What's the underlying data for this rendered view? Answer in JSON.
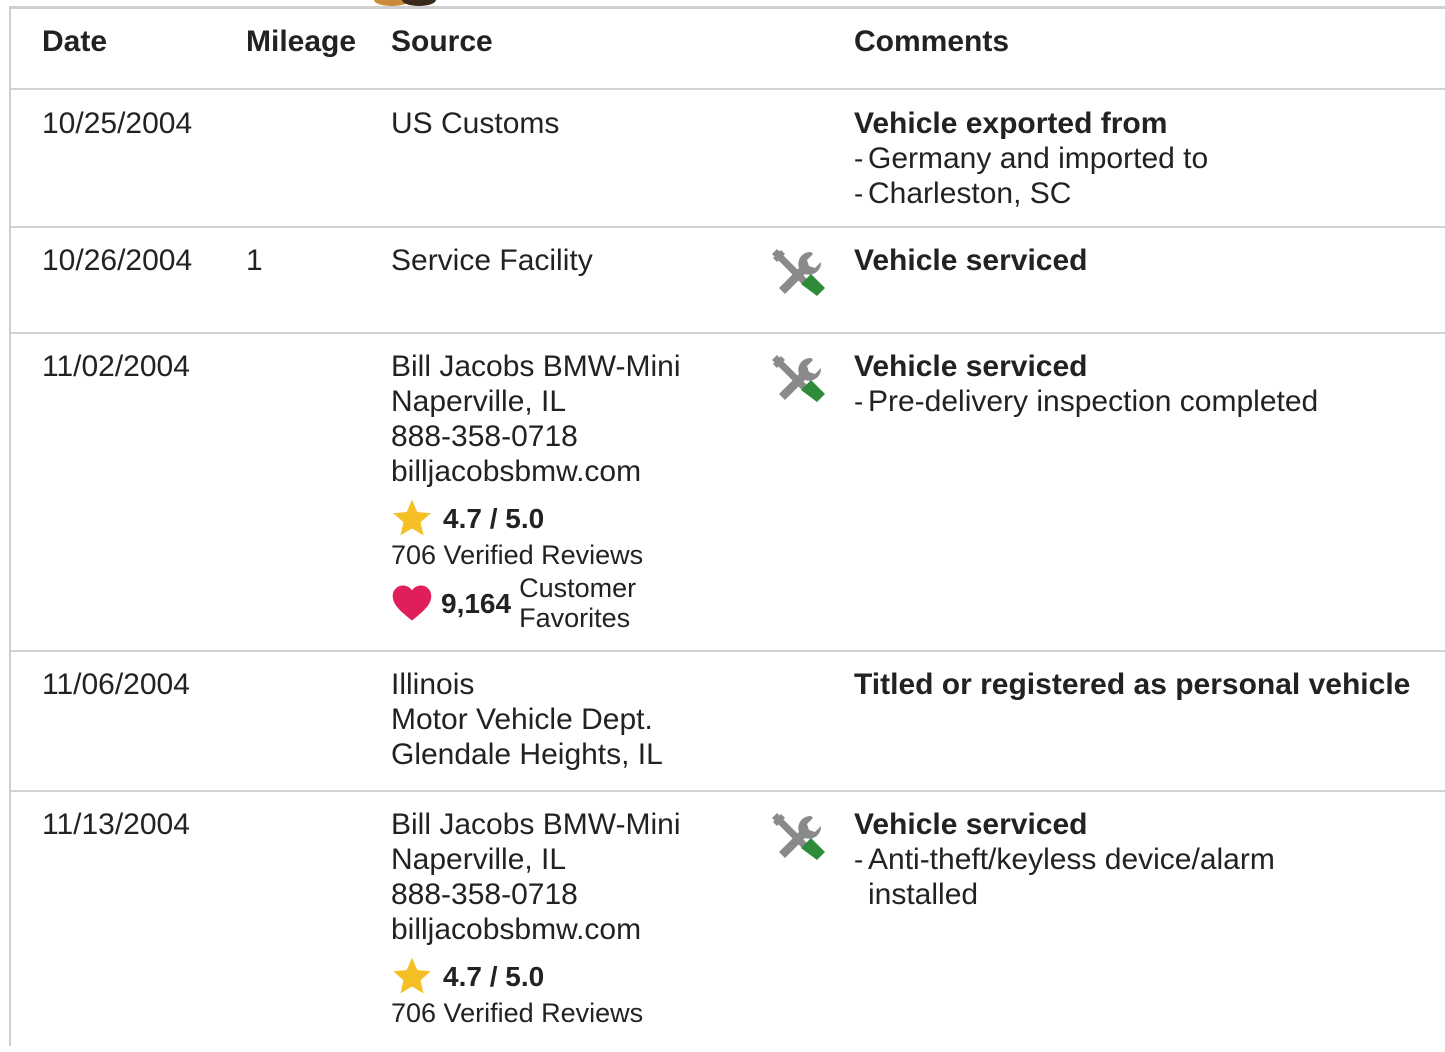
{
  "table": {
    "headers": {
      "date": "Date",
      "mileage": "Mileage",
      "source": "Source",
      "comments": "Comments"
    },
    "rows": [
      {
        "date": "10/25/2004",
        "mileage": "",
        "source": [
          "US Customs"
        ],
        "icon": "",
        "comment_title": "Vehicle exported from",
        "comment_items": [
          "Germany and imported to",
          "Charleston, SC"
        ]
      },
      {
        "date": "10/26/2004",
        "mileage": "1",
        "source": [
          "Service Facility"
        ],
        "icon": "wrench-screwdriver-icon",
        "comment_title": "Vehicle serviced",
        "comment_items": []
      },
      {
        "date": "11/02/2004",
        "mileage": "",
        "source": [
          "Bill Jacobs BMW-Mini",
          "Naperville, IL",
          "888-358-0718",
          "billjacobsbmw.com"
        ],
        "rating": "4.7 / 5.0",
        "reviews": "706 Verified Reviews",
        "favorites_count": "9,164",
        "favorites_label_1": "Customer",
        "favorites_label_2": "Favorites",
        "icon": "wrench-screwdriver-icon",
        "comment_title": "Vehicle serviced",
        "comment_items": [
          "Pre-delivery inspection completed"
        ]
      },
      {
        "date": "11/06/2004",
        "mileage": "",
        "source": [
          "Illinois",
          "Motor Vehicle Dept.",
          "Glendale Heights, IL"
        ],
        "icon": "",
        "comment_title": "Titled or registered as personal vehicle",
        "comment_items": []
      },
      {
        "date": "11/13/2004",
        "mileage": "",
        "source": [
          "Bill Jacobs BMW-Mini",
          "Naperville, IL",
          "888-358-0718",
          "billjacobsbmw.com"
        ],
        "rating": "4.7 / 5.0",
        "reviews": "706 Verified Reviews",
        "icon": "wrench-screwdriver-icon",
        "comment_title": "Vehicle serviced",
        "comment_items": [
          "Anti-theft/keyless device/alarm installed"
        ]
      }
    ]
  },
  "colors": {
    "star": "#f5c025",
    "heart": "#e01e5a",
    "wrench_gray": "#8a8a8a",
    "screwdriver_green": "#2e8b3a",
    "divider": "#d4d4d4"
  },
  "dash": "-"
}
